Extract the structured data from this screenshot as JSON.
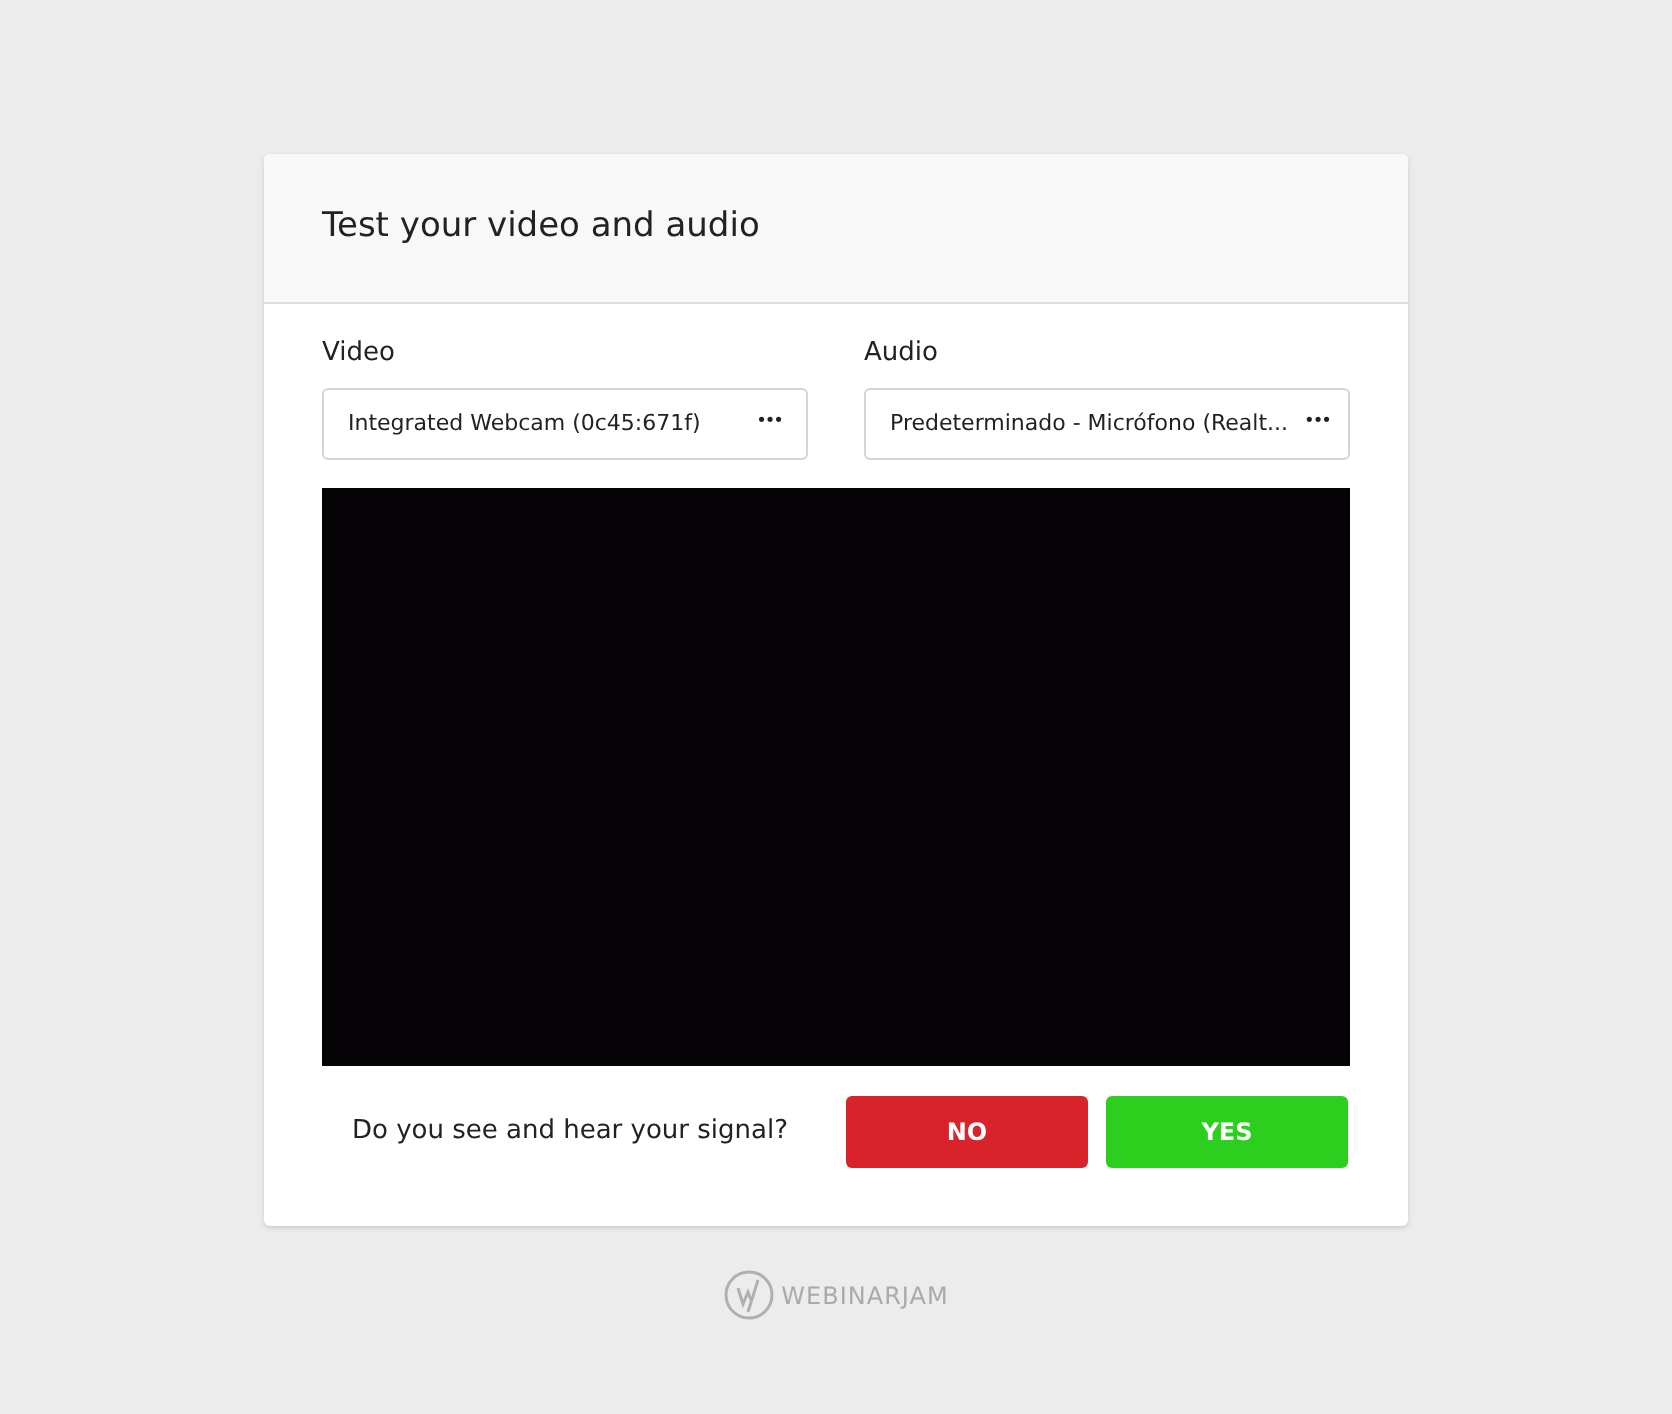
{
  "dialog": {
    "title": "Test your video and audio"
  },
  "selectors": [
    {
      "label": "Video",
      "value": "Integrated Webcam (0c45:671f)",
      "menu": "•••"
    },
    {
      "label": "Audio",
      "value": "Predeterminado - Micrófono (Realt...",
      "menu": "•••"
    }
  ],
  "prompt": "Do you see and hear your signal?",
  "buttons": [
    {
      "label": "NO",
      "kind": "negative"
    },
    {
      "label": "YES",
      "kind": "positive"
    }
  ],
  "footer": {
    "brand": "WEBINARJAM"
  }
}
